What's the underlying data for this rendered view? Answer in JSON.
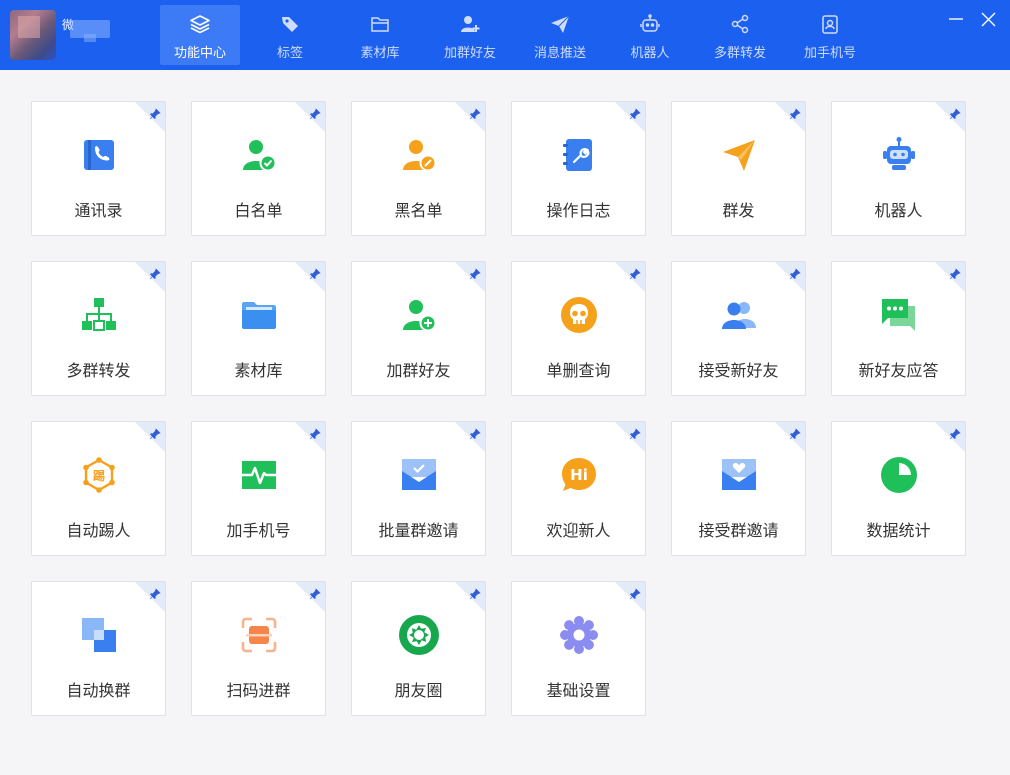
{
  "app": {
    "username_partial": "微"
  },
  "nav": [
    {
      "label": "功能中心",
      "icon": "layers-icon",
      "active": true
    },
    {
      "label": "标签",
      "icon": "tag-icon"
    },
    {
      "label": "素材库",
      "icon": "folder-icon"
    },
    {
      "label": "加群好友",
      "icon": "add-user-icon"
    },
    {
      "label": "消息推送",
      "icon": "paper-plane-icon"
    },
    {
      "label": "机器人",
      "icon": "robot-icon"
    },
    {
      "label": "多群转发",
      "icon": "share-icon"
    },
    {
      "label": "加手机号",
      "icon": "contact-card-icon"
    }
  ],
  "features": [
    {
      "label": "通讯录",
      "icon": "address-book-icon",
      "color": "#3a7ff0"
    },
    {
      "label": "白名单",
      "icon": "user-check-icon",
      "color": "#1fbf5a"
    },
    {
      "label": "黑名单",
      "icon": "user-block-icon",
      "color": "#f5a11c"
    },
    {
      "label": "操作日志",
      "icon": "log-book-icon",
      "color": "#3a7ff0"
    },
    {
      "label": "群发",
      "icon": "paper-plane-icon",
      "color": "#f5a11c"
    },
    {
      "label": "机器人",
      "icon": "robot-icon",
      "color": "#3a7ff0"
    },
    {
      "label": "多群转发",
      "icon": "org-chart-icon",
      "color": "#1fbf5a"
    },
    {
      "label": "素材库",
      "icon": "folder-icon",
      "color": "#3a8ff0"
    },
    {
      "label": "加群好友",
      "icon": "user-add-icon",
      "color": "#1fbf5a"
    },
    {
      "label": "单删查询",
      "icon": "skull-icon",
      "color": "#f5a11c"
    },
    {
      "label": "接受新好友",
      "icon": "users-icon",
      "color": "#3a7ff0"
    },
    {
      "label": "新好友应答",
      "icon": "chat-icon",
      "color": "#1fbf5a"
    },
    {
      "label": "自动踢人",
      "icon": "kick-hexagon-icon",
      "color": "#f5a11c",
      "glyph": "踢"
    },
    {
      "label": "加手机号",
      "icon": "heartbeat-icon",
      "color": "#1fbf5a"
    },
    {
      "label": "批量群邀请",
      "icon": "invite-mail-icon",
      "color": "#3a7ff0"
    },
    {
      "label": "欢迎新人",
      "icon": "hi-bubble-icon",
      "color": "#f5a11c",
      "glyph": "Hi"
    },
    {
      "label": "接受群邀请",
      "icon": "heart-mail-icon",
      "color": "#3a7ff0"
    },
    {
      "label": "数据统计",
      "icon": "pie-chart-icon",
      "color": "#1fbf5a"
    },
    {
      "label": "自动换群",
      "icon": "swap-squares-icon",
      "color": "#3a7ff0"
    },
    {
      "label": "扫码进群",
      "icon": "scan-icon",
      "color": "#f5854a"
    },
    {
      "label": "朋友圈",
      "icon": "aperture-icon",
      "color": "#1fbf5a"
    },
    {
      "label": "基础设置",
      "icon": "gear-icon",
      "color": "#8a8cf0"
    }
  ]
}
